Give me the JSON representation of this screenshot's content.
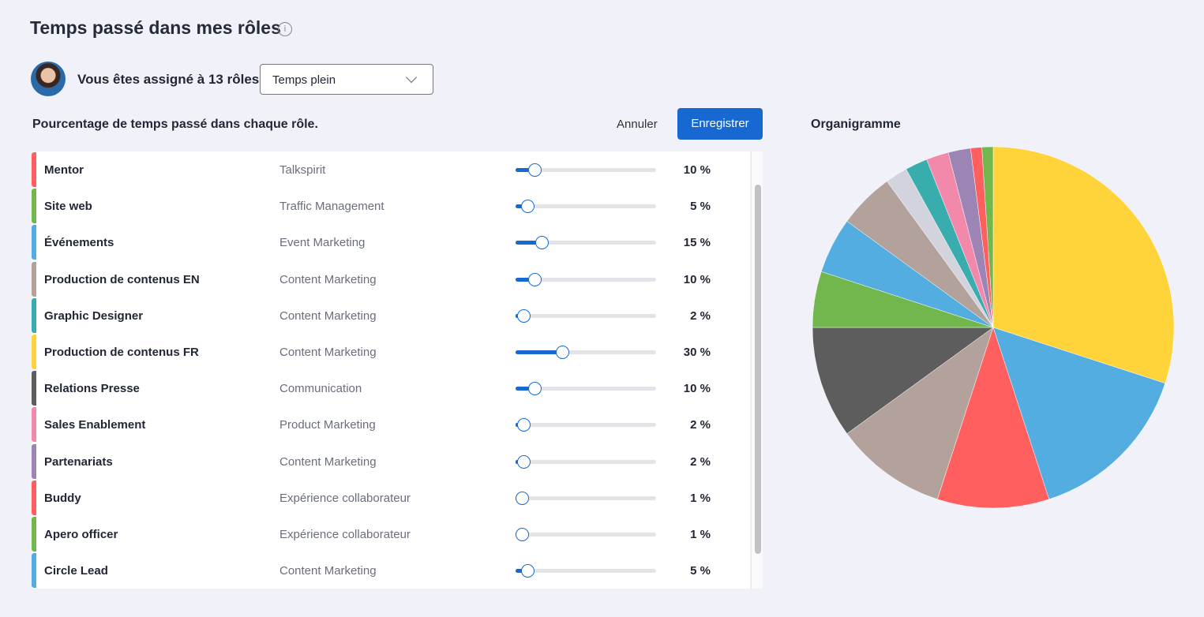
{
  "header": {
    "title": "Temps passé dans mes rôles",
    "info_icon": "info-icon"
  },
  "assignment": {
    "text": "Vous êtes assigné à 13 rôles",
    "select_value": "Temps plein"
  },
  "section": {
    "subtitle": "Pourcentage de temps passé dans chaque rôle.",
    "cancel_label": "Annuler",
    "save_label": "Enregistrer",
    "accent": "#1769d1"
  },
  "roles": [
    {
      "name": "Mentor",
      "category": "Talkspirit",
      "percent": 10,
      "label": "10 %",
      "color": "#ff5f5f"
    },
    {
      "name": "Site web",
      "category": "Traffic Management",
      "percent": 5,
      "label": "5 %",
      "color": "#72b74e"
    },
    {
      "name": "Événements",
      "category": "Event Marketing",
      "percent": 15,
      "label": "15 %",
      "color": "#53ade1"
    },
    {
      "name": "Production de contenus EN",
      "category": "Content Marketing",
      "percent": 10,
      "label": "10 %",
      "color": "#b3a29b"
    },
    {
      "name": "Graphic Designer",
      "category": "Content Marketing",
      "percent": 2,
      "label": "2 %",
      "color": "#39adad"
    },
    {
      "name": "Production de contenus FR",
      "category": "Content Marketing",
      "percent": 30,
      "label": "30 %",
      "color": "#ffd33a"
    },
    {
      "name": "Relations Presse",
      "category": "Communication",
      "percent": 10,
      "label": "10 %",
      "color": "#5d5d5d"
    },
    {
      "name": "Sales Enablement",
      "category": "Product Marketing",
      "percent": 2,
      "label": "2 %",
      "color": "#f288aa"
    },
    {
      "name": "Partenariats",
      "category": "Content Marketing",
      "percent": 2,
      "label": "2 %",
      "color": "#9c84b4"
    },
    {
      "name": "Buddy",
      "category": "Expérience collaborateur",
      "percent": 1,
      "label": "1 %",
      "color": "#ff5f5f"
    },
    {
      "name": "Apero officer",
      "category": "Expérience collaborateur",
      "percent": 1,
      "label": "1 %",
      "color": "#72b74e"
    },
    {
      "name": "Circle Lead",
      "category": "Content Marketing",
      "percent": 5,
      "label": "5 %",
      "color": "#53ade1"
    }
  ],
  "chart_data": {
    "type": "pie",
    "title": "Organigramme",
    "slices": [
      {
        "value": 30,
        "color": "#ffd33a"
      },
      {
        "value": 15,
        "color": "#53ade1"
      },
      {
        "value": 10,
        "color": "#ff5f5f"
      },
      {
        "value": 10,
        "color": "#b3a29b"
      },
      {
        "value": 10,
        "color": "#5d5d5d"
      },
      {
        "value": 5,
        "color": "#72b74e"
      },
      {
        "value": 5,
        "color": "#53ade1"
      },
      {
        "value": 5,
        "color": "#b3a29b"
      },
      {
        "value": 2,
        "color": "#d2d3dc"
      },
      {
        "value": 2,
        "color": "#39adad"
      },
      {
        "value": 2,
        "color": "#f288aa"
      },
      {
        "value": 2,
        "color": "#9c84b4"
      },
      {
        "value": 1,
        "color": "#ff5f5f"
      },
      {
        "value": 1,
        "color": "#72b74e"
      }
    ]
  }
}
